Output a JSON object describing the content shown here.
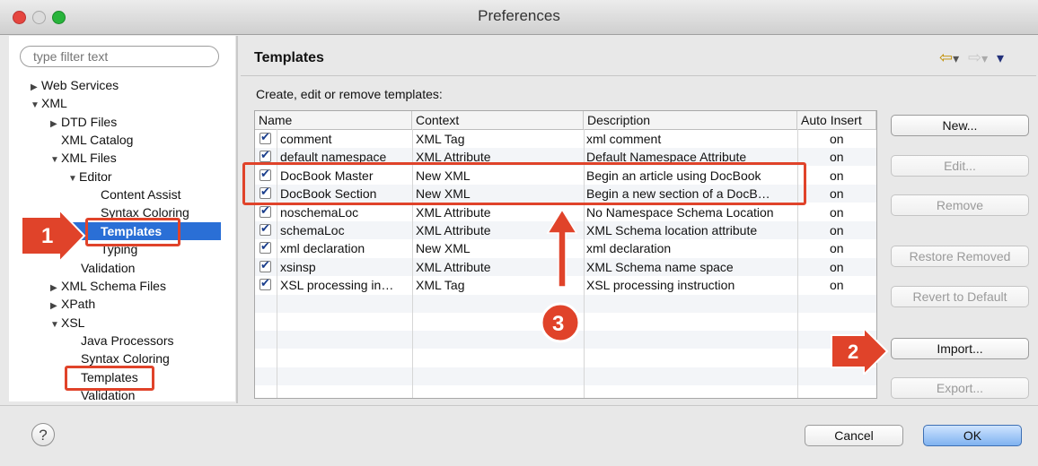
{
  "window": {
    "title": "Preferences"
  },
  "filter": {
    "placeholder": "type filter text"
  },
  "tree": [
    {
      "label": "Web Services",
      "arrow": "▶"
    },
    {
      "label": "XML",
      "arrow": "▼"
    },
    {
      "label": "DTD Files",
      "arrow": "▶"
    },
    {
      "label": "XML Catalog",
      "arrow": ""
    },
    {
      "label": "XML Files",
      "arrow": "▼"
    },
    {
      "label": "Editor",
      "arrow": "▼"
    },
    {
      "label": "Content Assist",
      "arrow": ""
    },
    {
      "label": "Syntax Coloring",
      "arrow": ""
    },
    {
      "label": "Templates",
      "arrow": ""
    },
    {
      "label": "Typing",
      "arrow": ""
    },
    {
      "label": "Validation",
      "arrow": ""
    },
    {
      "label": "XML Schema Files",
      "arrow": "▶"
    },
    {
      "label": "XPath",
      "arrow": "▶"
    },
    {
      "label": "XSL",
      "arrow": "▼"
    },
    {
      "label": "Java Processors",
      "arrow": ""
    },
    {
      "label": "Syntax Coloring",
      "arrow": ""
    },
    {
      "label": "Templates",
      "arrow": ""
    },
    {
      "label": "Validation",
      "arrow": ""
    }
  ],
  "panel": {
    "title": "Templates",
    "description": "Create, edit or remove templates:",
    "nav": {
      "back": "⇦",
      "forward": "⇨",
      "menu": "▾"
    }
  },
  "table": {
    "headers": [
      "Name",
      "Context",
      "Description",
      "Auto Insert"
    ],
    "rows": [
      {
        "name": "comment",
        "context": "XML Tag",
        "description": "xml comment",
        "auto": "on",
        "checked": true
      },
      {
        "name": "default namespace",
        "context": "XML Attribute",
        "description": "Default Namespace Attribute",
        "auto": "on",
        "checked": true
      },
      {
        "name": "DocBook Master",
        "context": "New XML",
        "description": "Begin an article using DocBook",
        "auto": "on",
        "checked": true
      },
      {
        "name": "DocBook Section",
        "context": "New XML",
        "description": "Begin a new section of a DocB…",
        "auto": "on",
        "checked": true
      },
      {
        "name": "noschemaLoc",
        "context": "XML Attribute",
        "description": "No Namespace Schema Location",
        "auto": "on",
        "checked": true
      },
      {
        "name": "schemaLoc",
        "context": "XML Attribute",
        "description": "XML Schema location attribute",
        "auto": "on",
        "checked": true
      },
      {
        "name": "xml declaration",
        "context": "New XML",
        "description": "xml declaration",
        "auto": "on",
        "checked": true
      },
      {
        "name": "xsinsp",
        "context": "XML Attribute",
        "description": "XML Schema name space",
        "auto": "on",
        "checked": true
      },
      {
        "name": "XSL processing in…",
        "context": "XML Tag",
        "description": "XSL processing instruction",
        "auto": "on",
        "checked": true
      }
    ]
  },
  "buttons": {
    "new": "New...",
    "edit": "Edit...",
    "remove": "Remove",
    "restore": "Restore Removed",
    "revert": "Revert to Default",
    "import": "Import...",
    "export": "Export..."
  },
  "footer": {
    "help": "?",
    "cancel": "Cancel",
    "ok": "OK"
  },
  "callouts": {
    "one": "1",
    "two": "2",
    "three": "3"
  },
  "colors": {
    "selection": "#2a6fd6",
    "callout": "#e0432a",
    "okButton": "#7fb2f0"
  }
}
